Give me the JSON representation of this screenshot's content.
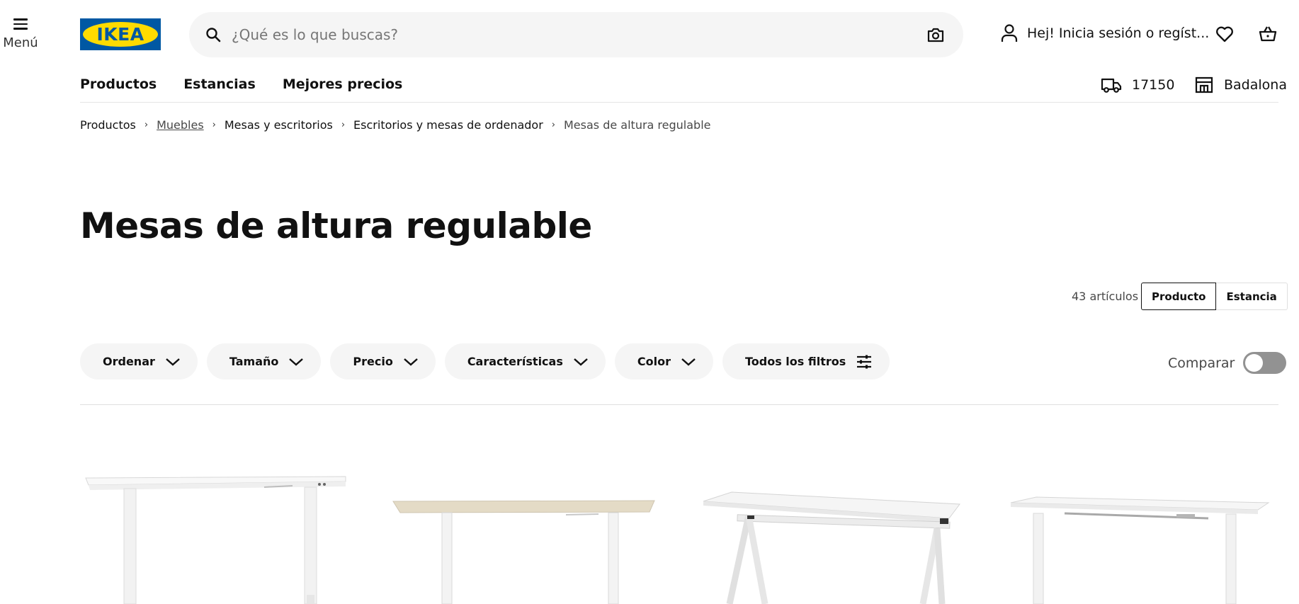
{
  "header": {
    "menu_label": "Menú",
    "logo_text": "IKEA",
    "search_placeholder": "¿Qué es lo que buscas?",
    "account_text": "Hej! Inicia sesión o regíst..."
  },
  "nav": {
    "items": [
      {
        "label": "Productos"
      },
      {
        "label": "Estancias"
      },
      {
        "label": "Mejores precios"
      }
    ],
    "postal_code": "17150",
    "store": "Badalona"
  },
  "breadcrumb": {
    "items": [
      {
        "label": "Productos"
      },
      {
        "label": "Muebles"
      },
      {
        "label": "Mesas y escritorios"
      },
      {
        "label": "Escritorios y mesas de ordenador"
      },
      {
        "label": "Mesas de altura regulable"
      }
    ]
  },
  "page": {
    "title": "Mesas de altura regulable",
    "results_count": "43 artículos",
    "view_product": "Producto",
    "view_room": "Estancia"
  },
  "filters": {
    "items": [
      {
        "label": "Ordenar"
      },
      {
        "label": "Tamaño"
      },
      {
        "label": "Precio"
      },
      {
        "label": "Características"
      },
      {
        "label": "Color"
      },
      {
        "label": "Todos los filtros"
      }
    ],
    "compare_label": "Comparar"
  },
  "colors": {
    "ikea_blue": "#0058a3",
    "ikea_yellow": "#ffdb00",
    "pill_bg": "#f5f5f5",
    "toggle_off": "#929292"
  },
  "icons": {
    "menu": "hamburger-icon",
    "search": "search-icon",
    "camera": "camera-icon",
    "account": "person-icon",
    "wishlist": "heart-icon",
    "cart": "basket-icon",
    "delivery": "truck-icon",
    "store": "store-icon"
  }
}
